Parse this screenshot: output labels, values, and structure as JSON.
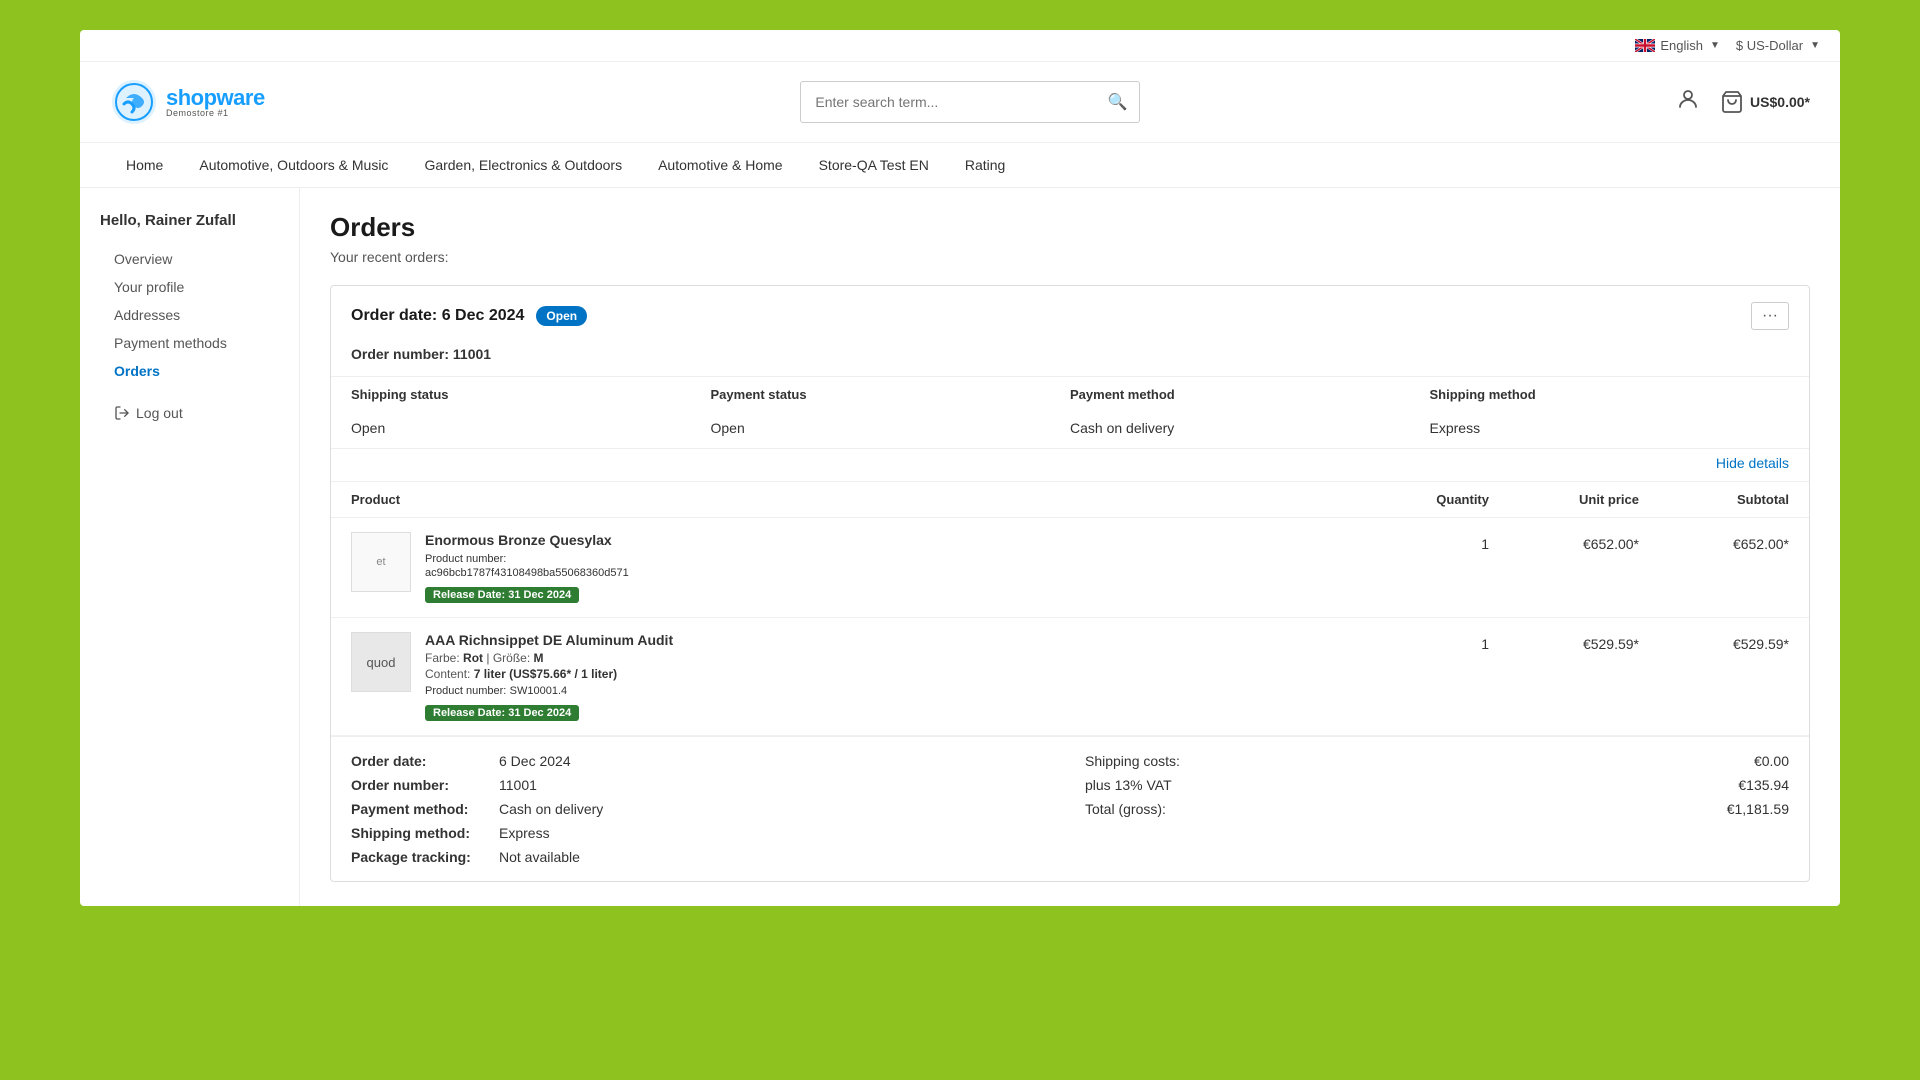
{
  "topbar": {
    "language": "English",
    "currency": "$ US-Dollar"
  },
  "header": {
    "logo_alt": "Shopware Demo Store",
    "search_placeholder": "Enter search term...",
    "cart_label": "US$0.00*"
  },
  "nav": {
    "items": [
      {
        "label": "Home",
        "active": false
      },
      {
        "label": "Automotive, Outdoors & Music",
        "active": false
      },
      {
        "label": "Garden, Electronics & Outdoors",
        "active": false
      },
      {
        "label": "Automotive & Home",
        "active": false
      },
      {
        "label": "Store-QA Test EN",
        "active": false
      },
      {
        "label": "Rating",
        "active": false
      }
    ]
  },
  "sidebar": {
    "greeting": "Hello, Rainer Zufall",
    "menu": [
      {
        "label": "Overview",
        "active": false
      },
      {
        "label": "Your profile",
        "active": false
      },
      {
        "label": "Addresses",
        "active": false
      },
      {
        "label": "Payment methods",
        "active": false
      },
      {
        "label": "Orders",
        "active": true
      }
    ],
    "logout_label": "Log out"
  },
  "orders": {
    "page_title": "Orders",
    "recent_label": "Your recent orders:",
    "order": {
      "date_label": "Order date: 6 Dec 2024",
      "status_badge": "Open",
      "order_number_label": "Order number:",
      "order_number": "11001",
      "status_table": {
        "headers": [
          "Shipping status",
          "Payment status",
          "Payment method",
          "Shipping method"
        ],
        "values": [
          "Open",
          "Open",
          "Cash on delivery",
          "Express"
        ]
      },
      "hide_details_btn": "Hide details",
      "products_table": {
        "headers": [
          "Product",
          "Quantity",
          "Unit price",
          "Subtotal"
        ],
        "products": [
          {
            "thumb_text": "et",
            "thumb_style": "text",
            "name": "Enormous Bronze Quesylax",
            "number_label": "Product number:",
            "number": "ac96bcb1787f43108498ba55068360d571",
            "release_badge": "Release Date: 31 Dec 2024",
            "quantity": "1",
            "unit_price": "€652.00*",
            "subtotal": "€652.00*",
            "attrs": []
          },
          {
            "thumb_text": "quod",
            "thumb_style": "grey",
            "name": "AAA Richnsippet DE Aluminum Audit",
            "farbe_label": "Farbe:",
            "farbe_value": "Rot",
            "groesse_label": "Größe:",
            "groesse_value": "M",
            "content_label": "Content:",
            "content_value": "7 liter (US$75.66* / 1 liter)",
            "number_label": "Product number:",
            "number": "SW10001.4",
            "release_badge": "Release Date: 31 Dec 2024",
            "quantity": "1",
            "unit_price": "€529.59*",
            "subtotal": "€529.59*"
          }
        ]
      },
      "footer": {
        "left": [
          {
            "label": "Order date:",
            "value": "6 Dec 2024"
          },
          {
            "label": "Order number:",
            "value": "11001"
          },
          {
            "label": "Payment method:",
            "value": "Cash on delivery"
          },
          {
            "label": "Shipping method:",
            "value": "Express"
          },
          {
            "label": "Package tracking:",
            "value": "Not available"
          }
        ],
        "right": [
          {
            "label": "Shipping costs:",
            "value": "€0.00"
          },
          {
            "label": "plus 13% VAT",
            "value": "€135.94"
          },
          {
            "label": "Total (gross):",
            "value": "€1,181.59"
          }
        ]
      }
    }
  }
}
